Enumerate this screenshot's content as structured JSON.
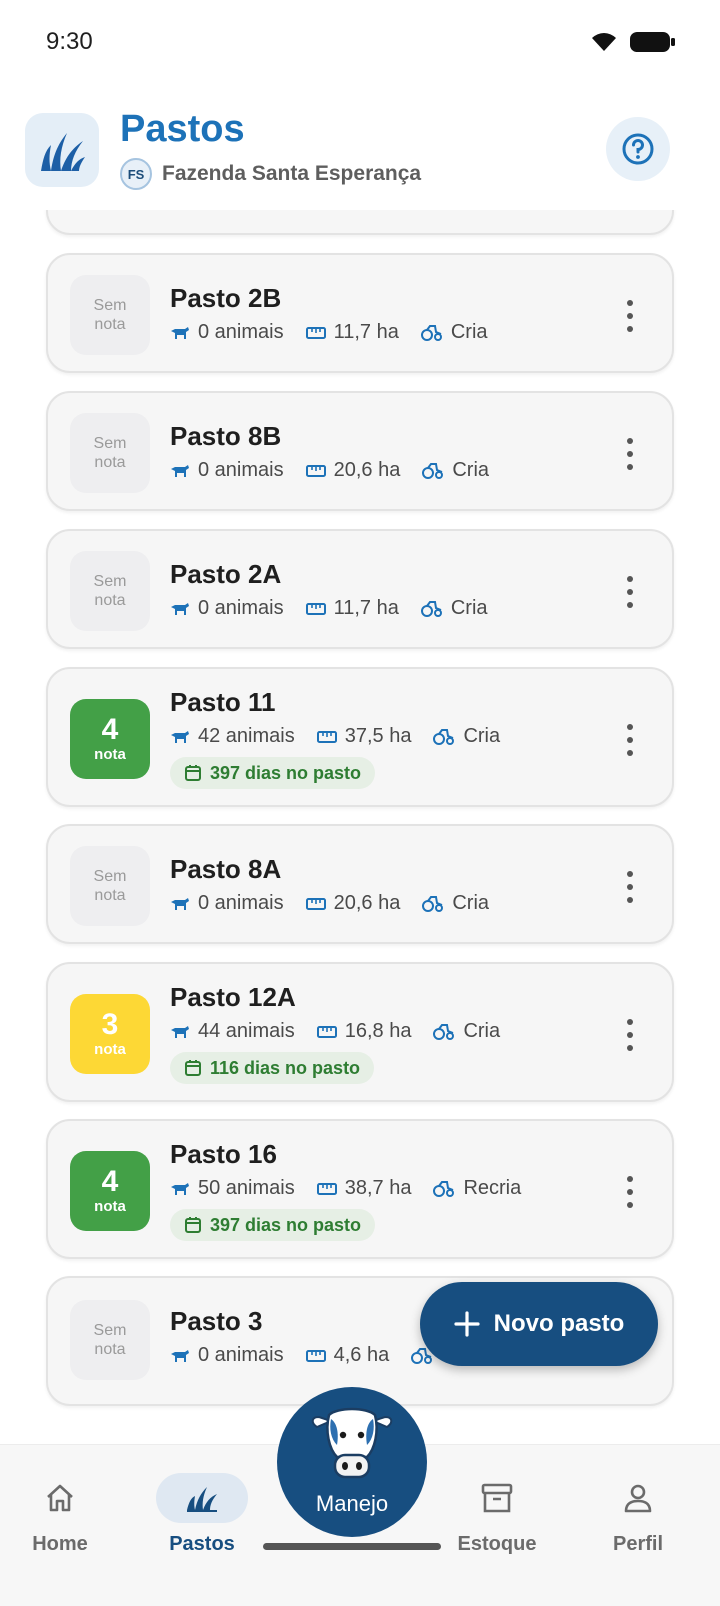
{
  "status_bar": {
    "time": "9:30"
  },
  "header": {
    "title": "Pastos",
    "farm_initials": "FS",
    "farm_name": "Fazenda Santa Esperança"
  },
  "labels": {
    "no_grade_line1": "Sem",
    "no_grade_line2": "nota",
    "grade_sub": "nota"
  },
  "pastures": [
    {
      "name": "Pasto 2B",
      "grade": null,
      "animals": "0 animais",
      "area": "11,7 ha",
      "category": "Cria",
      "days": null
    },
    {
      "name": "Pasto 8B",
      "grade": null,
      "animals": "0 animais",
      "area": "20,6 ha",
      "category": "Cria",
      "days": null
    },
    {
      "name": "Pasto 2A",
      "grade": null,
      "animals": "0 animais",
      "area": "11,7 ha",
      "category": "Cria",
      "days": null
    },
    {
      "name": "Pasto 11",
      "grade": "4",
      "grade_color": "#43a047",
      "animals": "42 animais",
      "area": "37,5 ha",
      "category": "Cria",
      "days": "397 dias no pasto"
    },
    {
      "name": "Pasto 8A",
      "grade": null,
      "animals": "0 animais",
      "area": "20,6 ha",
      "category": "Cria",
      "days": null
    },
    {
      "name": "Pasto 12A",
      "grade": "3",
      "grade_color": "#fdd835",
      "animals": "44 animais",
      "area": "16,8 ha",
      "category": "Cria",
      "days": "116 dias no pasto"
    },
    {
      "name": "Pasto 16",
      "grade": "4",
      "grade_color": "#43a047",
      "animals": "50 animais",
      "area": "38,7 ha",
      "category": "Recria",
      "days": "397 dias no pasto"
    },
    {
      "name": "Pasto 3",
      "grade": null,
      "animals": "0 animais",
      "area": "4,6 ha",
      "category": "",
      "days": null
    }
  ],
  "fab": {
    "label": "Novo pasto",
    "icon": "plus-icon"
  },
  "nav": {
    "home": "Home",
    "pastos": "Pastos",
    "manejo": "Manejo",
    "estoque": "Estoque",
    "perfil": "Perfil"
  },
  "colors": {
    "primary": "#174e80",
    "title_blue": "#1d72b8",
    "grade_green": "#43a047",
    "grade_yellow": "#fdd835",
    "days_green": "#2e7d32"
  }
}
